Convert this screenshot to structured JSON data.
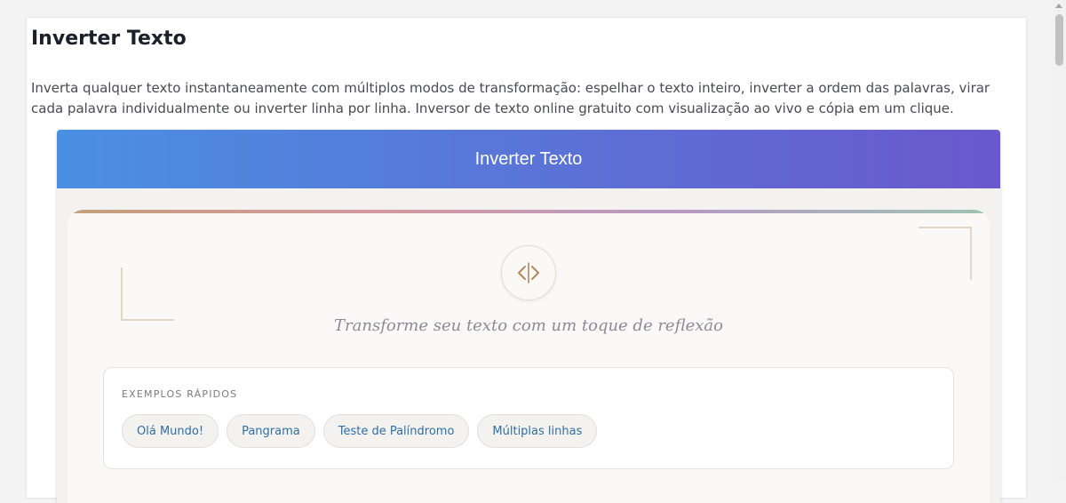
{
  "page": {
    "title": "Inverter Texto",
    "description": "Inverta qualquer texto instantaneamente com múltiplos modos de transformação: espelhar o texto inteiro, inverter a ordem das palavras, virar cada palavra individualmente ou inverter linha por linha. Inversor de texto online gratuito com visualização ao vivo e cópia em um clique."
  },
  "widget": {
    "header_title": "Inverter Texto",
    "tagline": "Transforme seu texto com um toque de reflexão",
    "icon": "mirror-code-icon",
    "examples": {
      "label": "EXEMPLOS RÁPIDOS",
      "chips": [
        {
          "label": "Olá Mundo!"
        },
        {
          "label": "Pangrama"
        },
        {
          "label": "Teste de Palíndromo"
        },
        {
          "label": "Múltiplas linhas"
        }
      ]
    }
  },
  "colors": {
    "header_gradient_start": "#4a90e2",
    "header_gradient_end": "#6a58cd",
    "chip_text": "#2d6fa6",
    "accent_gold": "#b08a5e"
  }
}
